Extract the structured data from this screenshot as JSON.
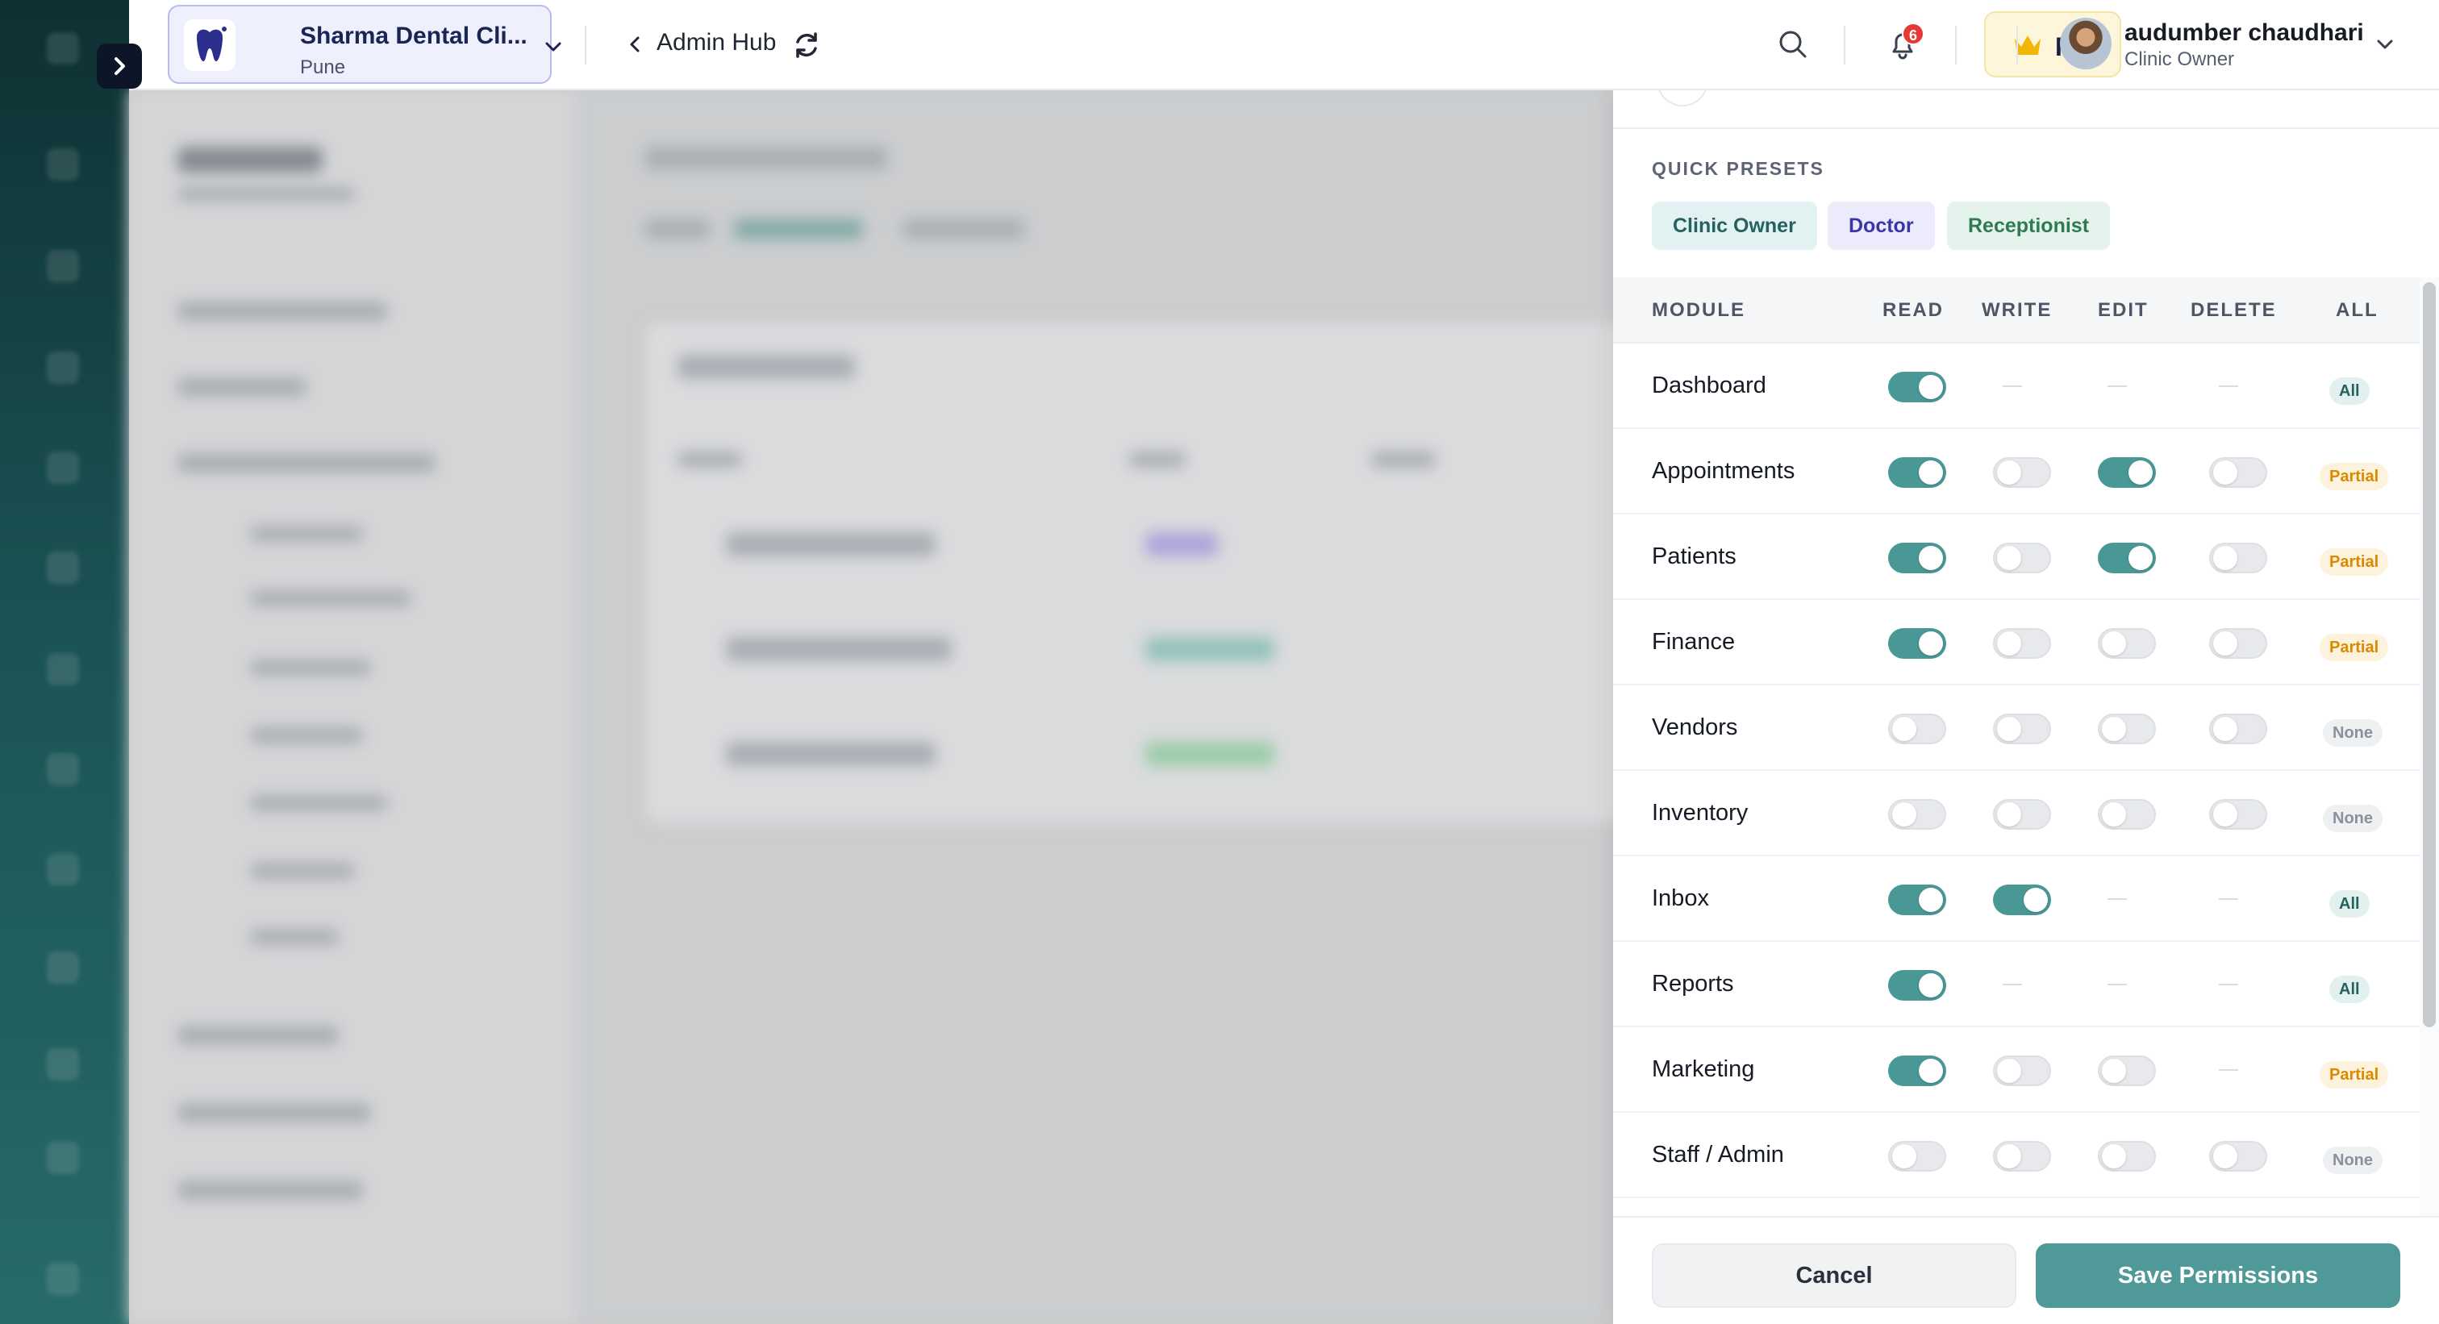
{
  "header": {
    "clinic_name": "Sharma Dental Cli...",
    "clinic_city": "Pune",
    "back_label": "Admin Hub",
    "notification_count": "6",
    "plan_label": "Pro",
    "user_name": "audumber chaudhari",
    "user_role": "Clinic Owner"
  },
  "presets": {
    "title": "QUICK PRESETS",
    "items": [
      "Clinic Owner",
      "Doctor",
      "Receptionist"
    ]
  },
  "permissions": {
    "columns": [
      "MODULE",
      "READ",
      "WRITE",
      "EDIT",
      "DELETE",
      "ALL"
    ],
    "rows": [
      {
        "module": "Dashboard",
        "read": "on",
        "write": "na",
        "edit": "na",
        "delete": "na",
        "status": "All"
      },
      {
        "module": "Appointments",
        "read": "on",
        "write": "off",
        "edit": "on",
        "delete": "off",
        "status": "Partial"
      },
      {
        "module": "Patients",
        "read": "on",
        "write": "off",
        "edit": "on",
        "delete": "off",
        "status": "Partial"
      },
      {
        "module": "Finance",
        "read": "on",
        "write": "off",
        "edit": "off",
        "delete": "off",
        "status": "Partial"
      },
      {
        "module": "Vendors",
        "read": "off",
        "write": "off",
        "edit": "off",
        "delete": "off",
        "status": "None"
      },
      {
        "module": "Inventory",
        "read": "off",
        "write": "off",
        "edit": "off",
        "delete": "off",
        "status": "None"
      },
      {
        "module": "Inbox",
        "read": "on",
        "write": "on",
        "edit": "na",
        "delete": "na",
        "status": "All"
      },
      {
        "module": "Reports",
        "read": "on",
        "write": "na",
        "edit": "na",
        "delete": "na",
        "status": "All"
      },
      {
        "module": "Marketing",
        "read": "on",
        "write": "off",
        "edit": "off",
        "delete": "na",
        "status": "Partial"
      },
      {
        "module": "Staff / Admin",
        "read": "off",
        "write": "off",
        "edit": "off",
        "delete": "off",
        "status": "None"
      }
    ]
  },
  "footer": {
    "cancel_label": "Cancel",
    "save_label": "Save Permissions"
  },
  "colors": {
    "accent": "#4a9896",
    "partial": "#d98a00",
    "badge_red": "#e53935"
  },
  "icons": {
    "rail_expand": "chevron-right-icon",
    "clinic_logo": "tooth-icon",
    "back": "chevron-left-icon",
    "refresh": "refresh-icon",
    "search": "search-icon",
    "notifications": "bell-icon",
    "plan": "crown-icon",
    "dropdown": "chevron-down-icon"
  }
}
